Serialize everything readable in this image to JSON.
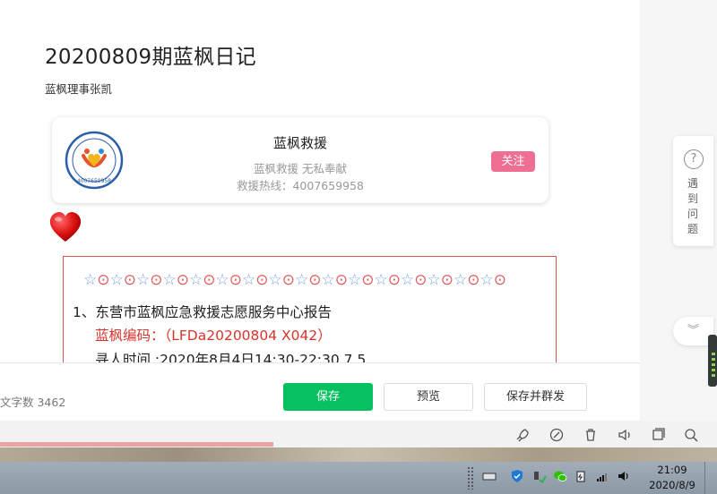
{
  "article": {
    "title": "20200809期蓝枫日记",
    "author": "蓝枫理事张凯"
  },
  "account_card": {
    "name": "蓝枫救援",
    "description": "蓝枫救援  无私奉献",
    "hotline": "救援热线：4007659958",
    "follow_label": "关注",
    "logo_number": "4007659958"
  },
  "report": {
    "star_pattern": "☆⊙☆⊙☆⊙☆⊙☆⊙☆⊙☆⊙☆⊙☆⊙☆⊙☆⊙☆⊙☆⊙☆⊙☆⊙☆⊙",
    "line1": "1、东营市蓝枫应急救援志愿服务中心报告",
    "line2": "蓝枫编码：（LFDa20200804  X042）",
    "line3": "寻人时间 :2020年8月4日14:30-22:30 7.5"
  },
  "footer": {
    "word_count": "文字数  3462",
    "save_label": "保存",
    "preview_label": "预览",
    "send_label": "保存并群发"
  },
  "help": {
    "icon_text": "?",
    "label": "遇到问题"
  },
  "taskbar": {
    "time": "21:09",
    "date": "2020/8/9"
  },
  "colors": {
    "primary_green": "#07c160",
    "follow_pink": "#ee6f93",
    "report_red": "#d9342b"
  }
}
